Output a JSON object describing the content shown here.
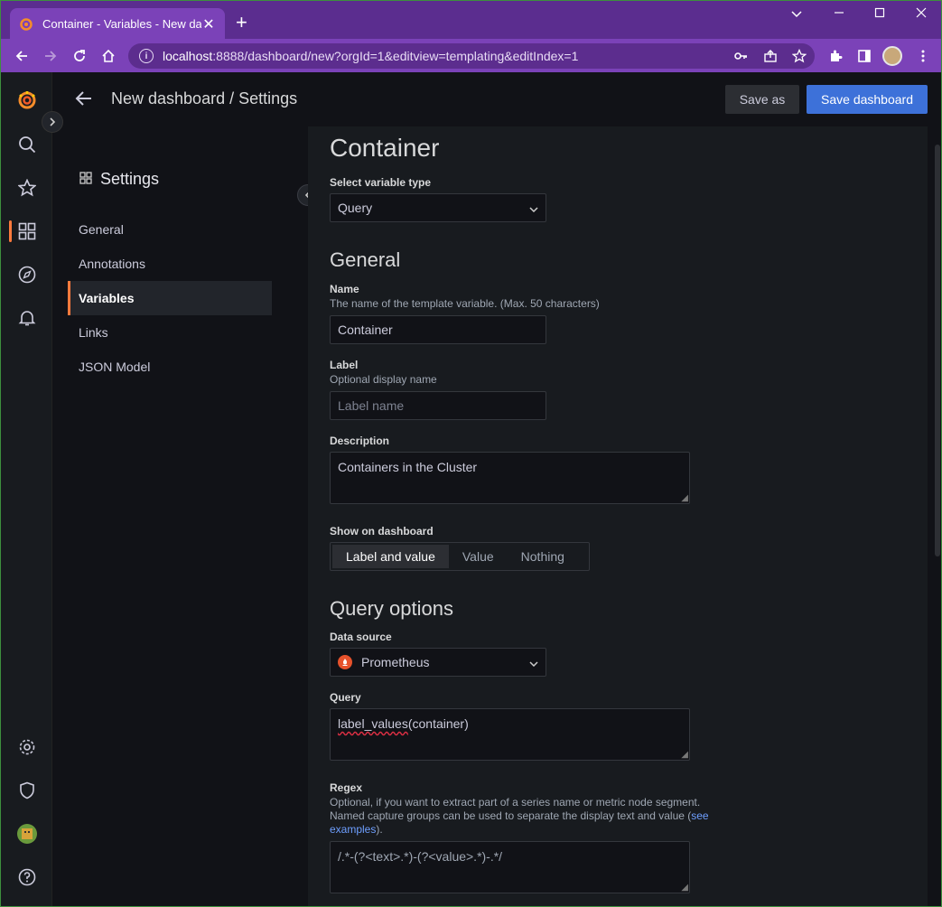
{
  "browser": {
    "tab_title": "Container - Variables - New dash",
    "url_host": "localhost",
    "url_rest": ":8888/dashboard/new?orgId=1&editview=templating&editIndex=1"
  },
  "header": {
    "title": "New dashboard / Settings",
    "save_as": "Save as",
    "save_dashboard": "Save dashboard"
  },
  "settings_nav": {
    "title": "Settings",
    "items": [
      "General",
      "Annotations",
      "Variables",
      "Links",
      "JSON Model"
    ],
    "active": "Variables"
  },
  "form": {
    "heading": "Container",
    "variable_type_label": "Select variable type",
    "variable_type": "Query",
    "general_heading": "General",
    "name_label": "Name",
    "name_desc": "The name of the template variable. (Max. 50 characters)",
    "name_value": "Container",
    "label_label": "Label",
    "label_desc": "Optional display name",
    "label_placeholder": "Label name",
    "description_label": "Description",
    "description_value": "Containers in the Cluster",
    "show_label": "Show on dashboard",
    "show_options": [
      "Label and value",
      "Value",
      "Nothing"
    ],
    "show_selected": "Label and value",
    "query_options_heading": "Query options",
    "datasource_label": "Data source",
    "datasource_value": "Prometheus",
    "query_label": "Query",
    "query_fn": "label_values",
    "query_rest": "(container)",
    "regex_label": "Regex",
    "regex_desc_1": "Optional, if you want to extract part of a series name or metric node segment.",
    "regex_desc_2": "Named capture groups can be used to separate the display text and value (",
    "regex_link_1": "see",
    "regex_link_2": "examples",
    "regex_desc_end": ").",
    "regex_value": "/.*-(?<text>.*)-(?<value>.*)-.*/"
  },
  "colors": {
    "accent": "#3d71d9",
    "active_indicator": "#ff7a3d",
    "browser_frame": "#7b42b8"
  }
}
